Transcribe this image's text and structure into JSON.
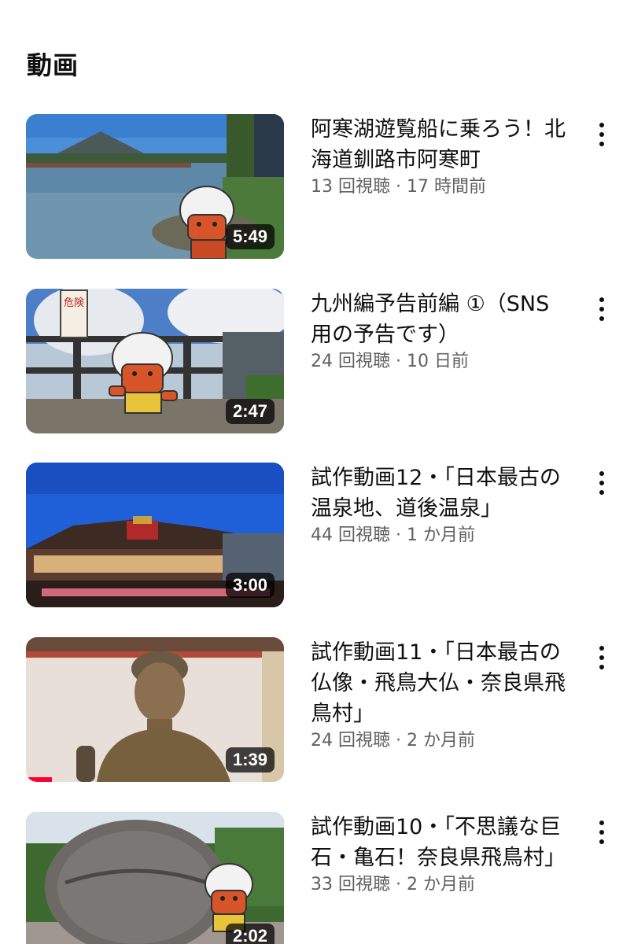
{
  "section": {
    "title": "動画"
  },
  "videos": [
    {
      "title": "阿寒湖遊覧船に乗ろう！北海道釧路市阿寒町",
      "views": "13 回視聴",
      "age": "17 時間前",
      "duration": "5:49",
      "progress": 0
    },
    {
      "title": "九州編予告前編 ①（SNS用の予告です）",
      "views": "24 回視聴",
      "age": "10 日前",
      "duration": "2:47",
      "progress": 0,
      "sign_text": "危険"
    },
    {
      "title": "試作動画12・「日本最古の温泉地、道後温泉」",
      "views": "44 回視聴",
      "age": "1 か月前",
      "duration": "3:00",
      "progress": 0
    },
    {
      "title": "試作動画11・「日本最古の仏像・飛鳥大仏・奈良県飛鳥村」",
      "views": "24 回視聴",
      "age": "2 か月前",
      "duration": "1:39",
      "progress": 0.1
    },
    {
      "title": "試作動画10・「不思議な巨石・亀石！奈良県飛鳥村」",
      "views": "33 回視聴",
      "age": "2 か月前",
      "duration": "2:02",
      "progress": 0
    }
  ],
  "meta_separator": " · ",
  "icons": {
    "more": "more-vert-icon"
  },
  "colors": {
    "progress": "#ff0033",
    "meta": "#606060"
  }
}
